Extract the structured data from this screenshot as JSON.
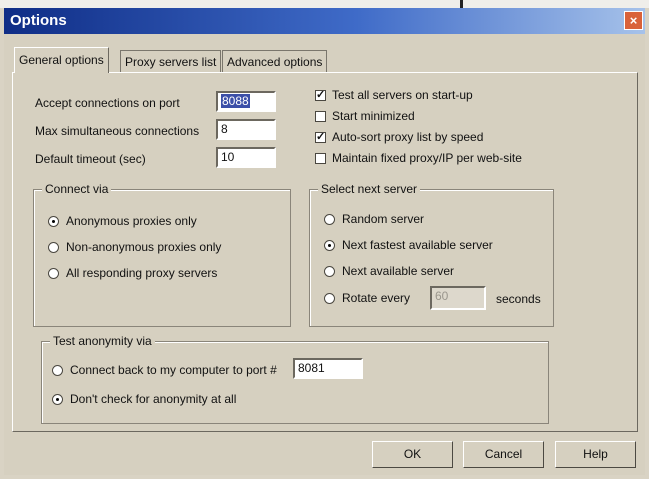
{
  "window": {
    "title": "Options",
    "close_glyph": "×"
  },
  "tabs": [
    {
      "label": "General options",
      "active": true
    },
    {
      "label": "Proxy servers list",
      "active": false
    },
    {
      "label": "Advanced options",
      "active": false
    }
  ],
  "fields": {
    "port": {
      "label": "Accept connections on port",
      "value": "8088"
    },
    "max_connections": {
      "label": "Max simultaneous connections",
      "value": "8"
    },
    "timeout": {
      "label": "Default timeout (sec)",
      "value": "10"
    }
  },
  "checkboxes": [
    {
      "label": "Test all servers on start-up",
      "checked": true
    },
    {
      "label": "Start minimized",
      "checked": false
    },
    {
      "label": "Auto-sort proxy list by speed",
      "checked": true
    },
    {
      "label": "Maintain fixed proxy/IP per web-site",
      "checked": false
    }
  ],
  "connect_via": {
    "title": "Connect via",
    "options": [
      {
        "label": "Anonymous proxies only",
        "selected": true
      },
      {
        "label": "Non-anonymous proxies only",
        "selected": false
      },
      {
        "label": "All responding proxy servers",
        "selected": false
      }
    ]
  },
  "select_next": {
    "title": "Select next server",
    "options": [
      {
        "label": "Random server",
        "selected": false
      },
      {
        "label": "Next fastest available server",
        "selected": true
      },
      {
        "label": "Next available server",
        "selected": false
      },
      {
        "label": "Rotate every",
        "selected": false
      }
    ],
    "rotate_value": "60",
    "rotate_suffix": "seconds"
  },
  "test_anonymity": {
    "title": "Test anonymity via",
    "connect_back_label": "Connect back to my computer to port #",
    "connect_back_port": "8081",
    "connect_back_selected": false,
    "no_check_label": "Don't check for anonymity at all",
    "no_check_selected": true
  },
  "buttons": {
    "ok": "OK",
    "cancel": "Cancel",
    "help": "Help"
  },
  "check_glyph": "✓",
  "icons": {
    "close": "close-icon",
    "checkbox": "checkbox-icon",
    "radio": "radio-icon"
  }
}
